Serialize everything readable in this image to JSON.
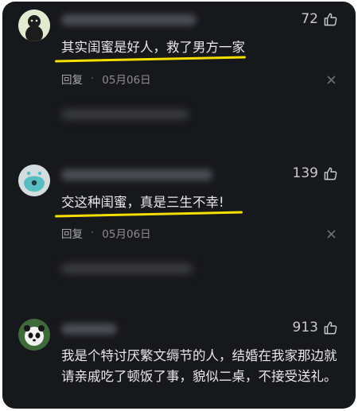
{
  "comments": [
    {
      "likes": "72",
      "text": "其实闺蜜是好人，救了男方一家",
      "reply_label": "回复",
      "date": "05月06日"
    },
    {
      "likes": "139",
      "text": "交这种闺蜜，真是三生不幸!",
      "reply_label": "回复",
      "date": "05月06日"
    },
    {
      "likes": "913",
      "text": "我是个特讨厌繁文缛节的人，结婚在我家那边就请亲戚吃了顿饭了事，貌似二桌，不接受送礼。"
    }
  ],
  "separator": "·",
  "colors": {
    "background": "#17181c",
    "highlight_underline": "#f5de00",
    "text": "#e8e8ea",
    "muted": "#8c8d93"
  }
}
